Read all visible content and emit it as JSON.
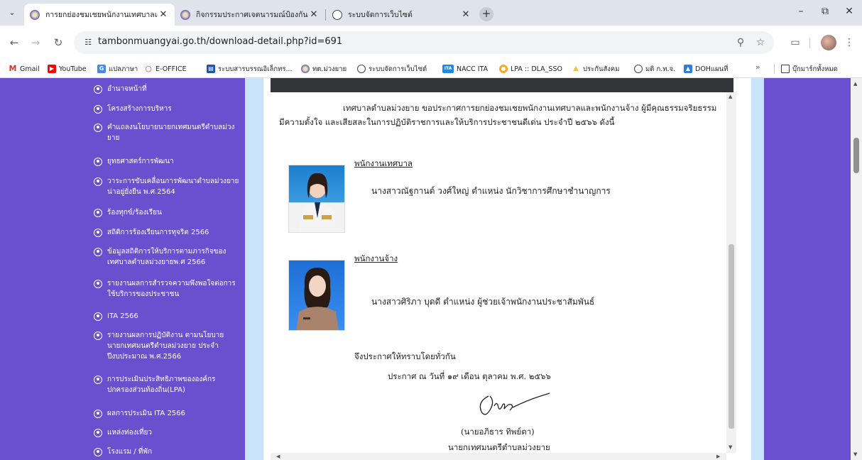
{
  "tabs": [
    {
      "title": "การยกย่องชมเชยพนักงานเทศบาลแล",
      "active": true
    },
    {
      "title": "กิจกรรมประกาศเจตนารมณ์ป้องกันแล",
      "active": false
    },
    {
      "title": "ระบบจัดการเว็บไซต์",
      "active": false
    }
  ],
  "toolbar": {
    "url": "tambonmuangyai.go.th/download-detail.php?id=691"
  },
  "bookmarks": [
    {
      "label": "Gmail"
    },
    {
      "label": "YouTube"
    },
    {
      "label": "แปลภาษา"
    },
    {
      "label": "E-OFFICE"
    },
    {
      "label": "ระบบสารบรรณอิเล็กทร..."
    },
    {
      "label": "ทต.ม่วงยาย"
    },
    {
      "label": "ระบบจัดการเว็บไซต์"
    },
    {
      "label": "NACC ITA"
    },
    {
      "label": "LPA :: DLA_SSO"
    },
    {
      "label": "ประกันสังคม"
    },
    {
      "label": "มติ ก.ท.จ."
    },
    {
      "label": "DOHแผนที่"
    }
  ],
  "bookmarks_all": "บุ๊กมาร์กทั้งหมด",
  "sidebar": {
    "items": [
      {
        "label": "อำนาจหน้าที่"
      },
      {
        "label": "โครงสร้างการบริหาร"
      },
      {
        "label": "คำแถลงนโยบายนายกเทศมนตรีตำบลม่วงยาย"
      },
      {
        "label": "ยุทธศาสตร์การพัฒนา"
      },
      {
        "label": "วาระการขับเคลื่อนการพัฒนาตำบลม่วงยายน่าอยู่ยั่งยืน พ.ศ.2564"
      },
      {
        "label": "ร้องทุกข์/ร้องเรียน"
      },
      {
        "label": "สถิติการร้องเรียนการทุจริต 2566"
      },
      {
        "label": "ข้อมูลสถิติการให้บริการตามภารกิจของเทศบาลตำบลม่วงยายพ.ศ 2566"
      },
      {
        "label": "รายงานผลการสำรวจความพึงพอใจต่อการใช้บริการของประชาชน"
      },
      {
        "label": "ITA 2566"
      },
      {
        "label": "รายงานผลการปฏิบัติงาน ตามนโยบายนายกเทศมนตรีตำบลม่วงยาย ประจำปีงบประมาณ พ.ศ.2566"
      },
      {
        "label": "การประเมินประสิทธิภาพขององค์กรปกครองส่วนท้องถิ่น(LPA)"
      },
      {
        "label": "ผลการประเมิน ITA 2566"
      },
      {
        "label": "แหล่งท่องเที่ยว"
      },
      {
        "label": "โรงแรม / ที่พัก"
      }
    ]
  },
  "document": {
    "intro": "เทศบาลตำบลม่วงยาย ขอประกาศการยกย่องชมเชยพนักงานเทศบาลและพนักงานจ้าง ผู้มีคุณธรรมจริยธรรม มีความตั้งใจ และเสียสละในการปฏิบัติราชการและให้บริการประชาชนดีเด่น ประจำปี ๒๕๖๖ ดังนี้",
    "section1_heading": "พนักงานเทศบาล",
    "section1_person": "นางสาวณัฐกานต์  วงศ์ใหญ่  ตำแหน่ง  นักวิชาการศึกษาชำนาญการ",
    "section2_heading": "พนักงานจ้าง",
    "section2_person": "นางสาวศิริภา  บุดดี  ตำแหน่ง  ผู้ช่วยเจ้าพนักงานประชาสัมพันธ์",
    "announce": "จึงประกาศให้ทราบโดยทั่วกัน",
    "date": "ประกาศ  ณ  วันที่  ๑๙  เดือน  ตุลาคม  พ.ศ. ๒๕๖๖",
    "signer_name": "(นายอภิธาร   ทิพย์ตา)",
    "signer_title": "นายกเทศมนตรีตำบลม่วงยาย"
  }
}
